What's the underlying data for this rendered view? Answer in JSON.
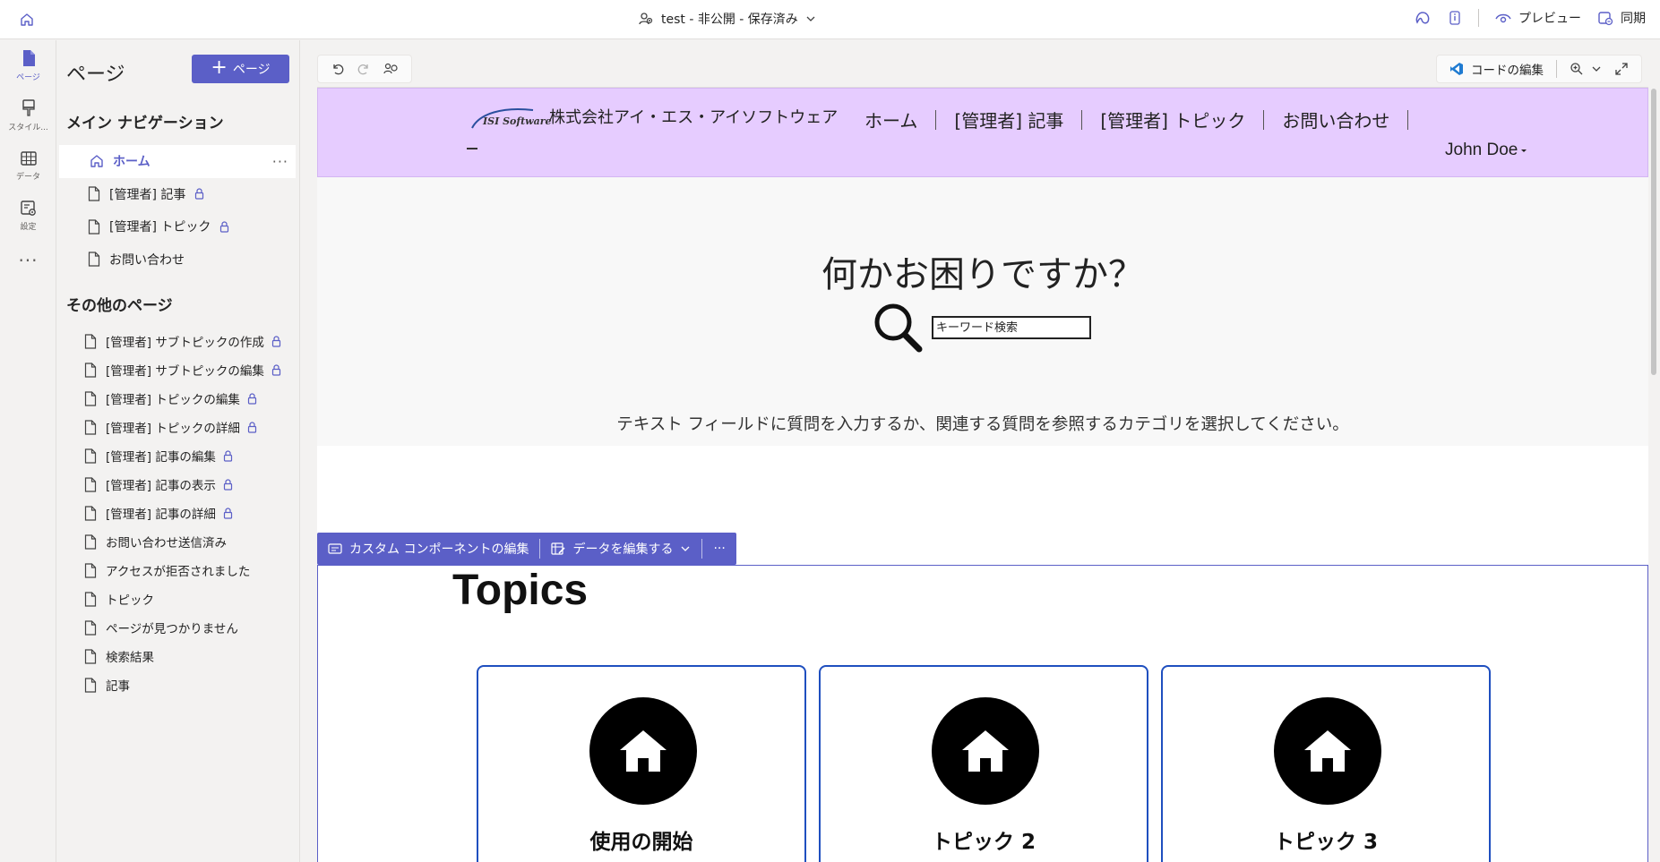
{
  "topbar": {
    "site_title": "test - 非公開 - 保存済み",
    "preview_label": "プレビュー",
    "sync_label": "同期"
  },
  "rail": {
    "items": [
      {
        "label": "ページ",
        "icon": "page-icon"
      },
      {
        "label": "スタイル...",
        "icon": "brush-icon"
      },
      {
        "label": "データ",
        "icon": "table-icon"
      },
      {
        "label": "設定",
        "icon": "settings-icon"
      }
    ],
    "more_label": "..."
  },
  "pages_panel": {
    "title": "ページ",
    "add_button_label": "ページ",
    "main_nav_title": "メイン ナビゲーション",
    "main_nav_items": [
      {
        "label": "ホーム",
        "locked": false,
        "selected": true
      },
      {
        "label": "[管理者] 記事",
        "locked": true
      },
      {
        "label": "[管理者] トピック",
        "locked": true
      },
      {
        "label": "お問い合わせ",
        "locked": false
      }
    ],
    "other_title": "その他のページ",
    "other_items": [
      {
        "label": "[管理者] サブトピックの作成",
        "locked": true
      },
      {
        "label": "[管理者] サブトピックの編集",
        "locked": true
      },
      {
        "label": "[管理者] トピックの編集",
        "locked": true
      },
      {
        "label": "[管理者] トピックの詳細",
        "locked": true
      },
      {
        "label": "[管理者] 記事の編集",
        "locked": true
      },
      {
        "label": "[管理者] 記事の表示",
        "locked": true
      },
      {
        "label": "[管理者] 記事の詳細",
        "locked": true
      },
      {
        "label": "お問い合わせ送信済み",
        "locked": false
      },
      {
        "label": "アクセスが拒否されました",
        "locked": false
      },
      {
        "label": "トピック",
        "locked": false
      },
      {
        "label": "ページが見つかりません",
        "locked": false
      },
      {
        "label": "検索結果",
        "locked": false
      },
      {
        "label": "記事",
        "locked": false
      }
    ]
  },
  "canvas_toolbar": {
    "edit_code_label": "コードの編集"
  },
  "site": {
    "logo_text": "ISI Software",
    "company_name": "株式会社アイ・エス・アイソフトウェア",
    "nav": [
      "ホーム",
      "[管理者] 記事",
      "[管理者] トピック",
      "お問い合わせ"
    ],
    "user_name": "John Doe",
    "hero_title": "何かお困りですか？",
    "search_placeholder": "キーワード検索",
    "hero_description": "テキスト フィールドに質問を入力するか、関連する質問を参照するカテゴリを選択してください。",
    "topics_title": "Topics",
    "topics": [
      "使用の開始",
      "トピック 2",
      "トピック 3"
    ]
  },
  "component_toolbar": {
    "edit_component_label": "カスタム コンポーネントの編集",
    "edit_data_label": "データを編集する"
  },
  "colors": {
    "accent": "#5b5fc7",
    "header_bg": "#e6ccff",
    "card_border": "#1f4fbf"
  }
}
